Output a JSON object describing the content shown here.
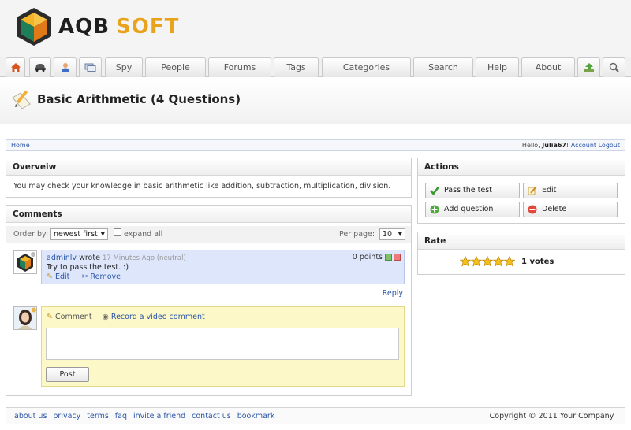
{
  "brand": {
    "word1": "AQB",
    "word2": "SOFT"
  },
  "nav": {
    "tabs": [
      {
        "label": "Spy"
      },
      {
        "label": "People"
      },
      {
        "label": "Forums"
      },
      {
        "label": "Tags"
      },
      {
        "label": "Categories"
      },
      {
        "label": "Search"
      },
      {
        "label": "Help"
      },
      {
        "label": "About"
      }
    ]
  },
  "page": {
    "title": "Basic Arithmetic (4 Questions)"
  },
  "breadcrumb": {
    "home": "Home",
    "greeting": "Hello,",
    "user": "Julia67",
    "exclaim": "!",
    "account": "Account",
    "logout": "Logout"
  },
  "overview": {
    "title": "Overveiw",
    "text": "You may check your knowledge in basic arithmetic like addition, subtraction, multiplication, division."
  },
  "comments": {
    "title": "Comments",
    "order_label": "Order by:",
    "order_value": "newest first",
    "expand_label": "expand all",
    "perpage_label": "Per page:",
    "perpage_value": "10",
    "items": [
      {
        "author": "adminlv",
        "verb": "wrote",
        "meta": "17 Minutes Ago (neutral)",
        "points": "0 points",
        "text": "Try to pass the test. :)",
        "edit": "Edit",
        "remove": "Remove"
      }
    ],
    "reply": "Reply",
    "compose": {
      "comment_tab": "Comment",
      "video_tab": "Record a video comment",
      "post": "Post"
    }
  },
  "actions": {
    "title": "Actions",
    "pass": "Pass the test",
    "edit": "Edit",
    "add_question": "Add question",
    "delete": "Delete"
  },
  "rate": {
    "title": "Rate",
    "stars": 5,
    "votes": "1 votes"
  },
  "footer": {
    "links": [
      "about us",
      "privacy",
      "terms",
      "faq",
      "invite a friend",
      "contact us",
      "bookmark"
    ],
    "copyright": "Copyright © 2011 Your Company."
  },
  "colors": {
    "accent": "#e9a21c",
    "link": "#2a55a8",
    "comment_bg": "#dde6fb",
    "reply_bg": "#fdf8c8"
  }
}
